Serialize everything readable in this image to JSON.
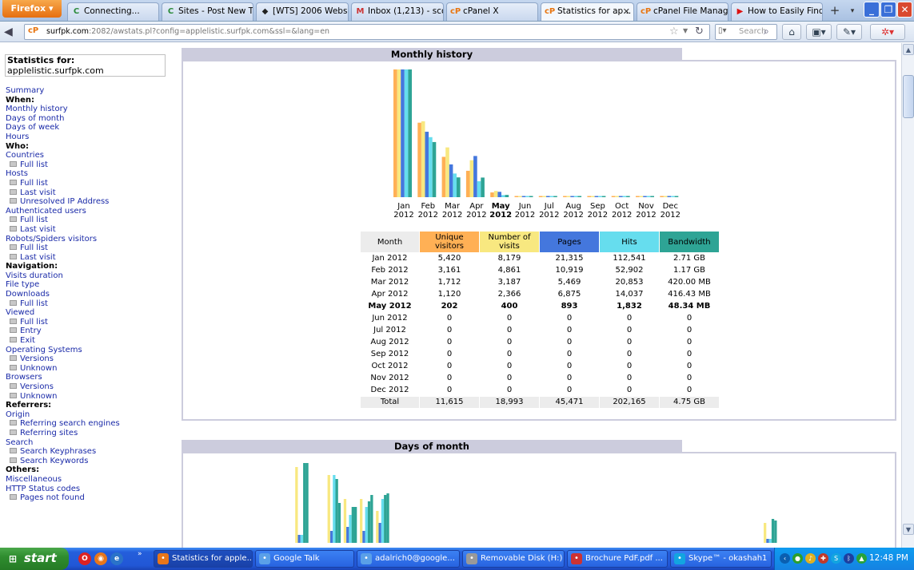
{
  "browser": {
    "app_button": "Firefox",
    "tabs": [
      {
        "label": "Connecting...",
        "icon": "loading-icon"
      },
      {
        "label": "Sites - Post New Th...",
        "icon": "loading-icon"
      },
      {
        "label": "[WTS] 2006 Websit...",
        "icon": "forum-icon"
      },
      {
        "label": "Inbox (1,213) - sco...",
        "icon": "gmail-icon"
      },
      {
        "label": "cPanel X",
        "icon": "cpanel-icon"
      },
      {
        "label": "Statistics for ap...",
        "icon": "cpanel-icon",
        "active": true
      },
      {
        "label": "cPanel File Manager...",
        "icon": "cpanel-icon"
      },
      {
        "label": "How to Easily Find ...",
        "icon": "youtube-icon"
      }
    ],
    "url_host": "surfpk.com",
    "url_path": ":2082/awstats.pl?config=applelistic.surfpk.com&ssl=&lang=en",
    "search_placeholder": "Search"
  },
  "sidebar": {
    "stats_for_label": "Statistics for:",
    "stats_for_domain": "applelistic.surfpk.com",
    "items": [
      {
        "t": "Summary",
        "k": "link"
      },
      {
        "t": "When:",
        "k": "head"
      },
      {
        "t": "Monthly history",
        "k": "link"
      },
      {
        "t": "Days of month",
        "k": "link"
      },
      {
        "t": "Days of week",
        "k": "link"
      },
      {
        "t": "Hours",
        "k": "link"
      },
      {
        "t": "Who:",
        "k": "head"
      },
      {
        "t": "Countries",
        "k": "link"
      },
      {
        "t": "Full list",
        "k": "sub"
      },
      {
        "t": "Hosts",
        "k": "link"
      },
      {
        "t": "Full list",
        "k": "sub"
      },
      {
        "t": "Last visit",
        "k": "sub"
      },
      {
        "t": "Unresolved IP Address",
        "k": "sub"
      },
      {
        "t": "Authenticated users",
        "k": "link"
      },
      {
        "t": "Full list",
        "k": "sub"
      },
      {
        "t": "Last visit",
        "k": "sub"
      },
      {
        "t": "Robots/Spiders visitors",
        "k": "link"
      },
      {
        "t": "Full list",
        "k": "sub"
      },
      {
        "t": "Last visit",
        "k": "sub"
      },
      {
        "t": "Navigation:",
        "k": "head"
      },
      {
        "t": "Visits duration",
        "k": "link"
      },
      {
        "t": "File type",
        "k": "link"
      },
      {
        "t": "Downloads",
        "k": "link"
      },
      {
        "t": "Full list",
        "k": "sub"
      },
      {
        "t": "Viewed",
        "k": "link"
      },
      {
        "t": "Full list",
        "k": "sub"
      },
      {
        "t": "Entry",
        "k": "sub"
      },
      {
        "t": "Exit",
        "k": "sub"
      },
      {
        "t": "Operating Systems",
        "k": "link"
      },
      {
        "t": "Versions",
        "k": "sub"
      },
      {
        "t": "Unknown",
        "k": "sub"
      },
      {
        "t": "Browsers",
        "k": "link"
      },
      {
        "t": "Versions",
        "k": "sub"
      },
      {
        "t": "Unknown",
        "k": "sub"
      },
      {
        "t": "Referrers:",
        "k": "head"
      },
      {
        "t": "Origin",
        "k": "link"
      },
      {
        "t": "Referring search engines",
        "k": "sub"
      },
      {
        "t": "Referring sites",
        "k": "sub"
      },
      {
        "t": "Search",
        "k": "link"
      },
      {
        "t": "Search Keyphrases",
        "k": "sub"
      },
      {
        "t": "Search Keywords",
        "k": "sub"
      },
      {
        "t": "Others:",
        "k": "head"
      },
      {
        "t": "Miscellaneous",
        "k": "link"
      },
      {
        "t": "HTTP Status codes",
        "k": "link"
      },
      {
        "t": "Pages not found",
        "k": "sub"
      }
    ]
  },
  "monthly_history": {
    "title": "Monthly history",
    "columns": [
      {
        "label": "Month",
        "color": "#ececec"
      },
      {
        "label": "Unique visitors",
        "color": "#ffb055"
      },
      {
        "label": "Number of visits",
        "color": "#f8e880"
      },
      {
        "label": "Pages",
        "color": "#4477dd"
      },
      {
        "label": "Hits",
        "color": "#66ddee"
      },
      {
        "label": "Bandwidth",
        "color": "#2ea495"
      }
    ],
    "rows": [
      {
        "month": "Jan 2012",
        "uv": "5,420",
        "visits": "8,179",
        "pages": "21,315",
        "hits": "112,541",
        "bw": "2.71 GB"
      },
      {
        "month": "Feb 2012",
        "uv": "3,161",
        "visits": "4,861",
        "pages": "10,919",
        "hits": "52,902",
        "bw": "1.17 GB"
      },
      {
        "month": "Mar 2012",
        "uv": "1,712",
        "visits": "3,187",
        "pages": "5,469",
        "hits": "20,853",
        "bw": "420.00 MB"
      },
      {
        "month": "Apr 2012",
        "uv": "1,120",
        "visits": "2,366",
        "pages": "6,875",
        "hits": "14,037",
        "bw": "416.43 MB"
      },
      {
        "month": "May 2012",
        "uv": "202",
        "visits": "400",
        "pages": "893",
        "hits": "1,832",
        "bw": "48.34 MB",
        "current": true
      },
      {
        "month": "Jun 2012",
        "uv": "0",
        "visits": "0",
        "pages": "0",
        "hits": "0",
        "bw": "0"
      },
      {
        "month": "Jul 2012",
        "uv": "0",
        "visits": "0",
        "pages": "0",
        "hits": "0",
        "bw": "0"
      },
      {
        "month": "Aug 2012",
        "uv": "0",
        "visits": "0",
        "pages": "0",
        "hits": "0",
        "bw": "0"
      },
      {
        "month": "Sep 2012",
        "uv": "0",
        "visits": "0",
        "pages": "0",
        "hits": "0",
        "bw": "0"
      },
      {
        "month": "Oct 2012",
        "uv": "0",
        "visits": "0",
        "pages": "0",
        "hits": "0",
        "bw": "0"
      },
      {
        "month": "Nov 2012",
        "uv": "0",
        "visits": "0",
        "pages": "0",
        "hits": "0",
        "bw": "0"
      },
      {
        "month": "Dec 2012",
        "uv": "0",
        "visits": "0",
        "pages": "0",
        "hits": "0",
        "bw": "0"
      }
    ],
    "total": {
      "month": "Total",
      "uv": "11,615",
      "visits": "18,993",
      "pages": "45,471",
      "hits": "202,165",
      "bw": "4.75 GB"
    }
  },
  "chart_data": [
    {
      "type": "bar",
      "categories": [
        "Jan 2012",
        "Feb 2012",
        "Mar 2012",
        "Apr 2012",
        "May 2012",
        "Jun 2012",
        "Jul 2012",
        "Aug 2012",
        "Sep 2012",
        "Oct 2012",
        "Nov 2012",
        "Dec 2012"
      ],
      "category_labels": [
        [
          "Jan",
          "2012"
        ],
        [
          "Feb",
          "2012"
        ],
        [
          "Mar",
          "2012"
        ],
        [
          "Apr",
          "2012"
        ],
        [
          "May",
          "2012"
        ],
        [
          "Jun",
          "2012"
        ],
        [
          "Jul",
          "2012"
        ],
        [
          "Aug",
          "2012"
        ],
        [
          "Sep",
          "2012"
        ],
        [
          "Oct",
          "2012"
        ],
        [
          "Nov",
          "2012"
        ],
        [
          "Dec",
          "2012"
        ]
      ],
      "current_index": 4,
      "series": [
        {
          "name": "Unique visitors",
          "color": "#ffb055",
          "values": [
            5420,
            3161,
            1712,
            1120,
            202,
            0,
            0,
            0,
            0,
            0,
            0,
            0
          ]
        },
        {
          "name": "Number of visits",
          "color": "#f8e880",
          "values": [
            8179,
            4861,
            3187,
            2366,
            400,
            0,
            0,
            0,
            0,
            0,
            0,
            0
          ]
        },
        {
          "name": "Pages",
          "color": "#4477dd",
          "values": [
            21315,
            10919,
            5469,
            6875,
            893,
            0,
            0,
            0,
            0,
            0,
            0,
            0
          ]
        },
        {
          "name": "Hits",
          "color": "#66ddee",
          "values": [
            112541,
            52902,
            20853,
            14037,
            1832,
            0,
            0,
            0,
            0,
            0,
            0,
            0
          ]
        },
        {
          "name": "Bandwidth",
          "color": "#2ea495",
          "values": [
            2.71,
            1.17,
            0.42,
            0.4164,
            0.0483,
            0,
            0,
            0,
            0,
            0,
            0,
            0
          ],
          "unit": "GB"
        }
      ]
    },
    {
      "type": "bar",
      "title": "Days of month",
      "note": "partially visible; only tops of bars shown",
      "day_groups": [
        {
          "day_index": 1,
          "heights_rel": [
            0.95,
            0.1,
            0.1,
            1.0,
            1.0
          ]
        },
        {
          "day_index": 3,
          "heights_rel": [
            0.85,
            0.15,
            0.85,
            0.8,
            0.5
          ]
        },
        {
          "day_index": 4,
          "heights_rel": [
            0.55,
            0.2,
            0.35,
            0.45,
            0.45
          ]
        },
        {
          "day_index": 5,
          "heights_rel": [
            0.55,
            0.15,
            0.45,
            0.52,
            0.6
          ]
        },
        {
          "day_index": 6,
          "heights_rel": [
            0.4,
            0.25,
            0.55,
            0.6,
            0.62
          ]
        },
        {
          "day_index": 30,
          "heights_rel": [
            0.25,
            0.05,
            0.05,
            0.3,
            0.28
          ]
        }
      ],
      "series_colors": [
        "#f8e880",
        "#4477dd",
        "#66ddee",
        "#2ea495",
        "#2ea495"
      ]
    }
  ],
  "days_of_month": {
    "title": "Days of month"
  },
  "taskbar": {
    "start_label": "start",
    "tasks": [
      {
        "label": "Statistics for apple...",
        "icon": "firefox-icon",
        "active": true
      },
      {
        "label": "Google Talk",
        "icon": "gtalk-icon"
      },
      {
        "label": "adalrich0@google...",
        "icon": "chat-icon"
      },
      {
        "label": "Removable Disk (H:)",
        "icon": "drive-icon"
      },
      {
        "label": "Brochure PdF.pdf ...",
        "icon": "pdf-icon"
      },
      {
        "label": "Skype™ - okashah1",
        "icon": "skype-icon"
      }
    ],
    "clock": "12:48 PM"
  }
}
